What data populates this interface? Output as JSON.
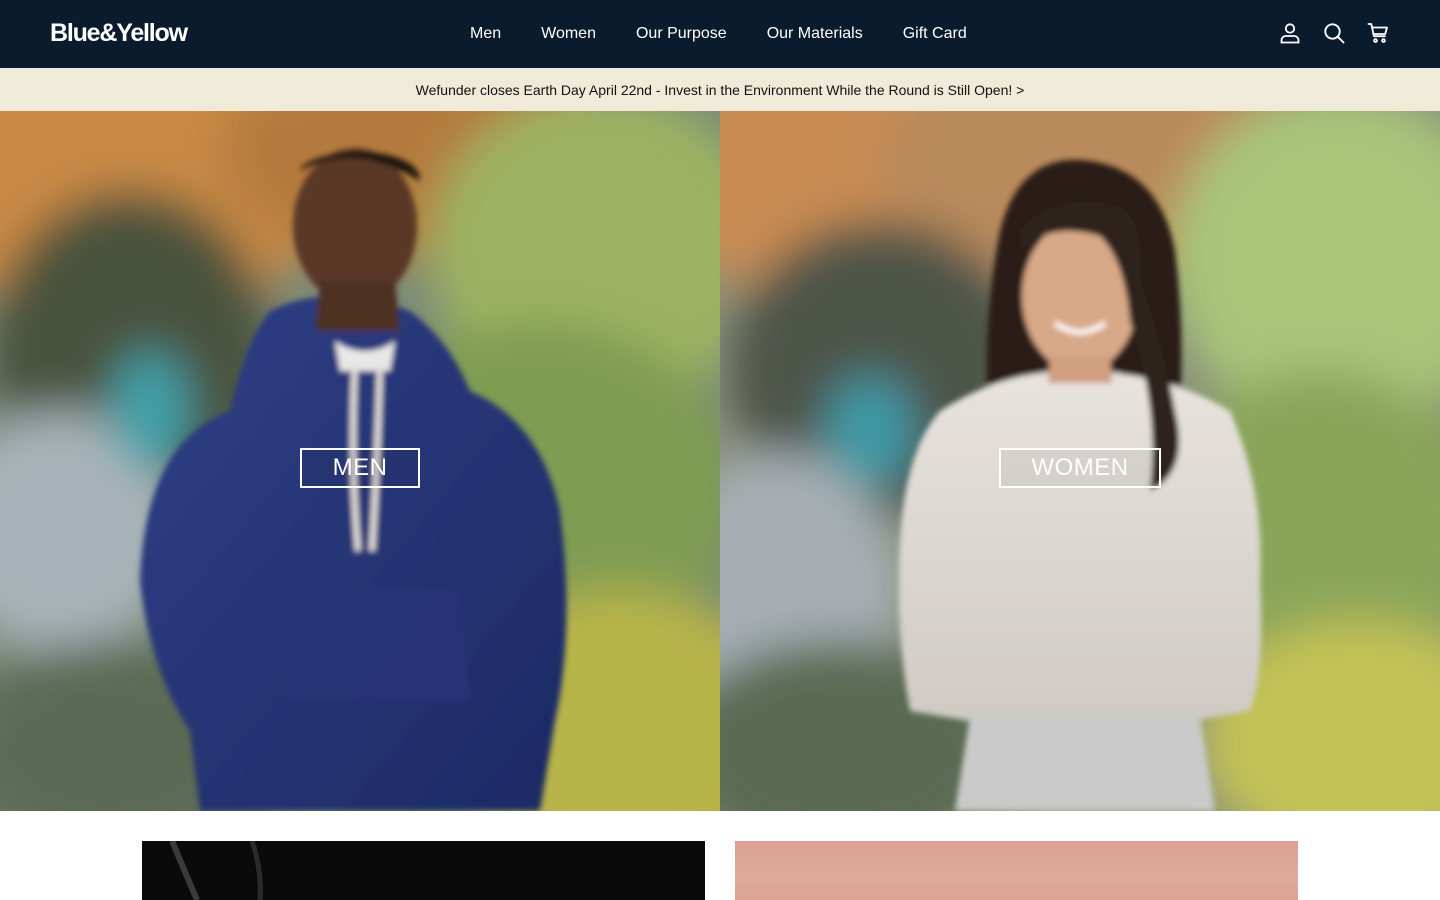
{
  "brand": {
    "logo_text": "Blue&Yellow"
  },
  "nav": {
    "items": [
      {
        "label": "Men"
      },
      {
        "label": "Women"
      },
      {
        "label": "Our Purpose"
      },
      {
        "label": "Our Materials"
      },
      {
        "label": "Gift Card"
      }
    ]
  },
  "header_icons": [
    "account-icon",
    "search-icon",
    "cart-icon"
  ],
  "announcement": {
    "text": "Wefunder closes Earth Day April 22nd - Invest in the Environment While the Round is Still Open! >"
  },
  "hero": {
    "men": {
      "button_label": "MEN"
    },
    "women": {
      "button_label": "WOMEN"
    }
  },
  "colors": {
    "header_bg": "#0b1b2e",
    "announcement_bg": "#f0ead8",
    "hero_button_border": "#ffffff"
  }
}
